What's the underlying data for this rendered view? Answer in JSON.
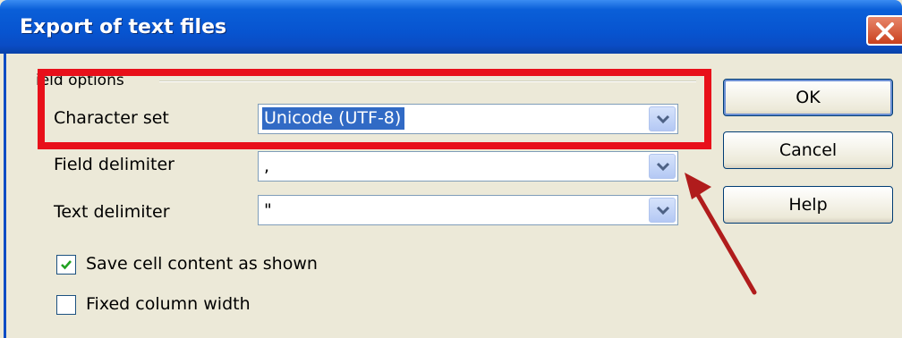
{
  "window": {
    "title": "Export of text files"
  },
  "field_options": {
    "group_label": "ield options",
    "character_set": {
      "label": "Character set",
      "value": "Unicode (UTF-8)"
    },
    "field_delimiter": {
      "label": "Field delimiter",
      "value": ","
    },
    "text_delimiter": {
      "label": "Text delimiter",
      "value": "\""
    },
    "save_cell_content": {
      "label": "Save cell content as shown",
      "checked": true
    },
    "fixed_column_width": {
      "label": "Fixed column width",
      "checked": false
    }
  },
  "buttons": {
    "ok": "OK",
    "cancel": "Cancel",
    "help": "Help"
  },
  "annotation": {
    "highlight_color": "#e8101a",
    "arrow_color": "#b01c1c"
  },
  "colors": {
    "titlebar": "#0754d0",
    "dialog_bg": "#ece9d8",
    "selection": "#316ac5"
  }
}
